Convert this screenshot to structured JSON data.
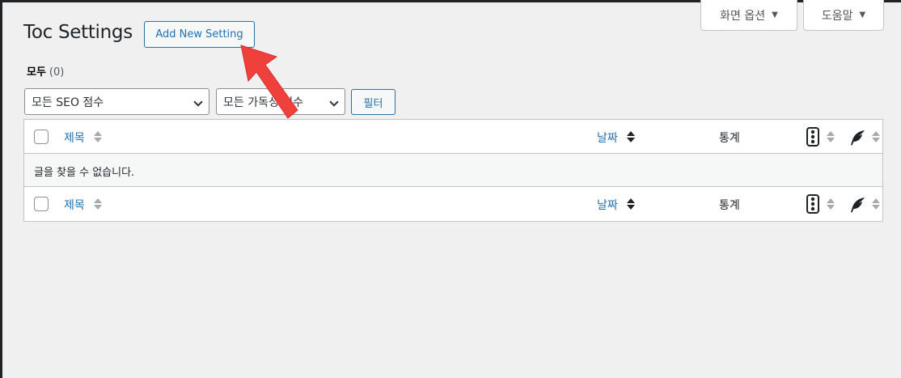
{
  "header": {
    "screen_options_label": "화면 옵션",
    "help_label": "도움말",
    "page_title": "Toc Settings",
    "add_new_label": "Add New Setting"
  },
  "views": {
    "all_label": "모두",
    "all_count": "(0)"
  },
  "filters": {
    "seo_select_value": "모든 SEO 점수",
    "readability_select_value": "모든 가독성 점수",
    "filter_button_label": "필터"
  },
  "table": {
    "columns": {
      "title": "제목",
      "date": "날짜",
      "stats": "통계"
    },
    "empty_message": "글을 찾을 수 없습니다."
  },
  "icons": {
    "seo_score": "traffic-light-icon",
    "readability": "feather-icon",
    "annotation_arrow": "red-arrow"
  },
  "colors": {
    "accent": "#2271b1",
    "annotation": "#f0403c"
  }
}
